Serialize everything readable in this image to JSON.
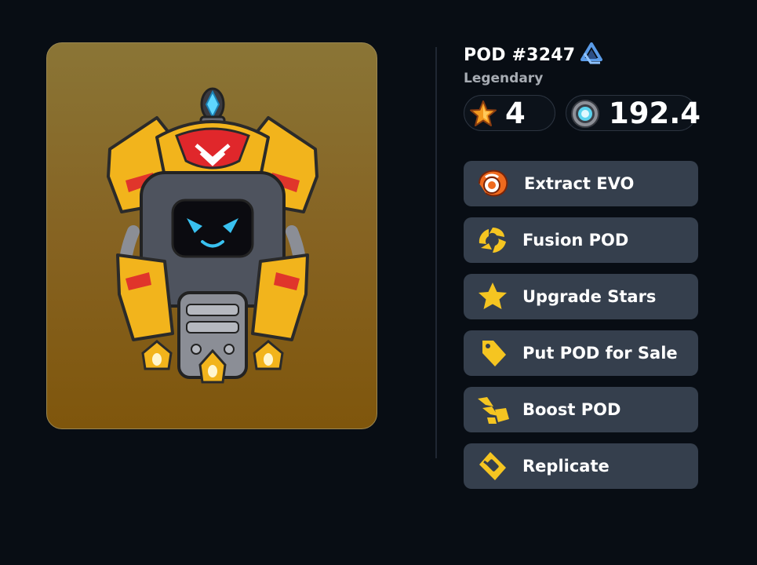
{
  "pod": {
    "title": "POD #3247",
    "rarity": "Legendary",
    "stars": "4",
    "power": "192.4"
  },
  "actions": [
    {
      "label": "Extract EVO",
      "icon": "evo-swirl-icon"
    },
    {
      "label": "Fusion POD",
      "icon": "fusion-icon"
    },
    {
      "label": "Upgrade Stars",
      "icon": "star-icon"
    },
    {
      "label": "Put POD for Sale",
      "icon": "price-tag-icon"
    },
    {
      "label": "Boost POD",
      "icon": "boost-flame-icon"
    },
    {
      "label": "Replicate",
      "icon": "replicate-icon"
    }
  ],
  "colors": {
    "background": "#080d14",
    "card_gold": "#866322",
    "button": "#353f4d",
    "accent_yellow": "#f5c521"
  }
}
